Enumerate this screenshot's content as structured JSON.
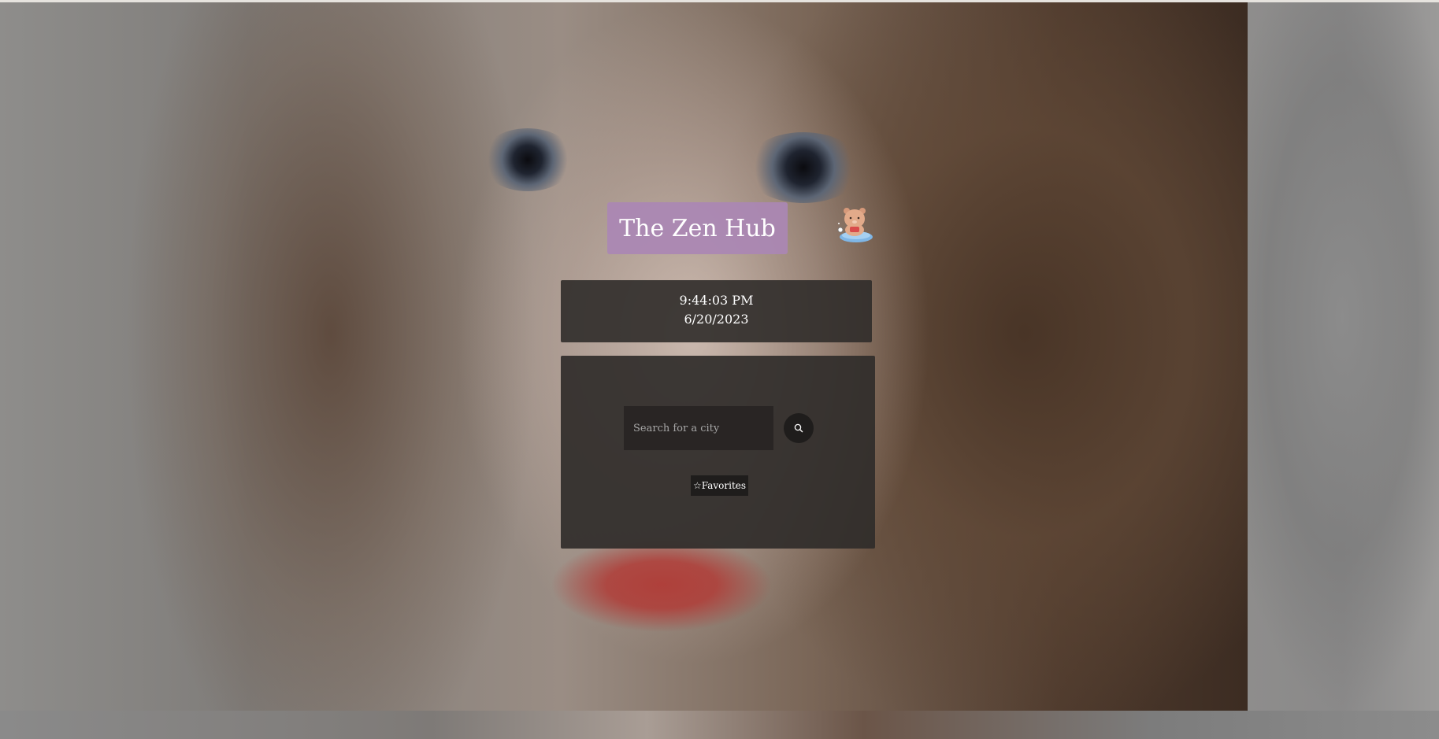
{
  "app": {
    "title": "The Zen Hub"
  },
  "clock": {
    "time": "9:44:03 PM",
    "date": "6/20/2023"
  },
  "weather": {
    "search_placeholder": "Search for a city",
    "search_value": "",
    "search_icon": "search-icon",
    "favorites_label": "☆Favorites"
  },
  "decor": {
    "mascot_icon": "bear-mascot-icon",
    "title_bg_color": "#aa87b4",
    "panel_color": "#302c2a"
  }
}
